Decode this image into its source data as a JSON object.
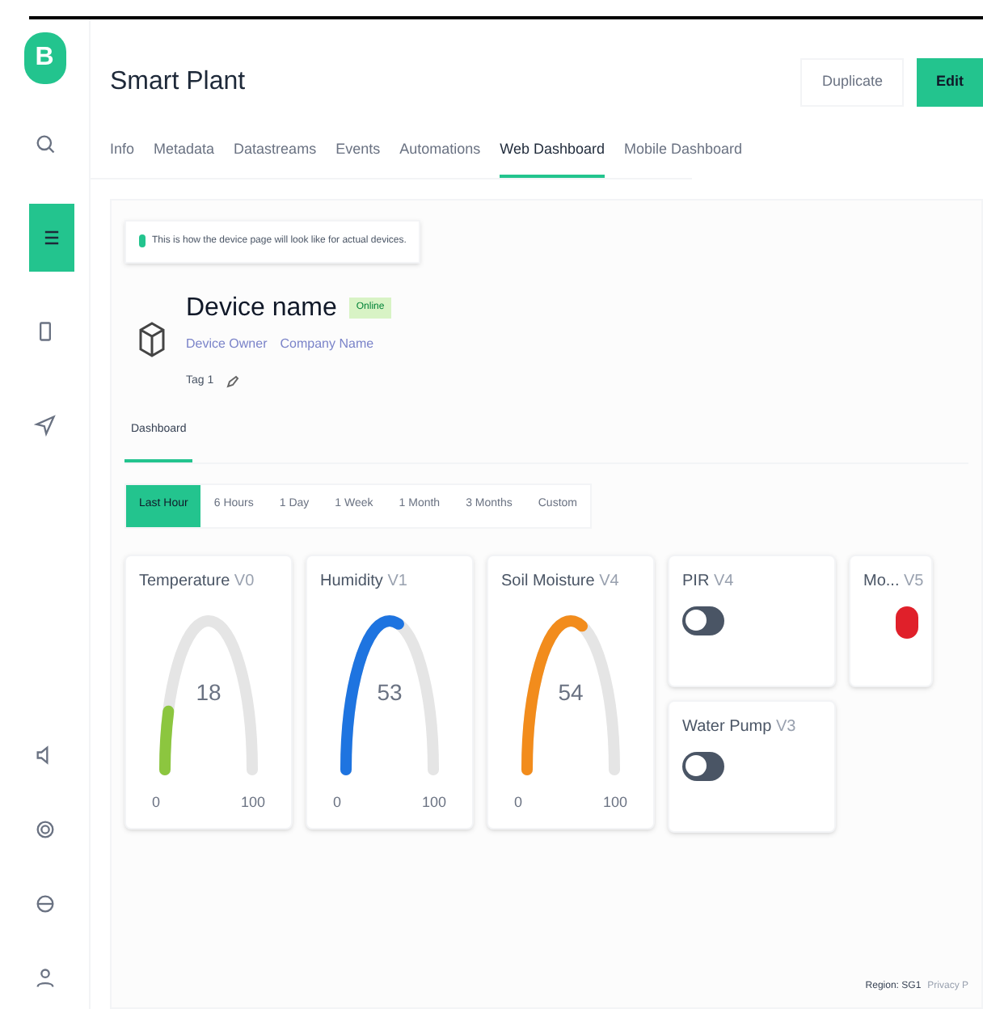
{
  "sidebar": {
    "logo": "B",
    "items": [
      {
        "selected": false
      },
      {
        "selected": true
      },
      {
        "selected": false
      },
      {
        "selected": false
      }
    ]
  },
  "header": {
    "title": "Smart Plant",
    "buttons": [
      {
        "label": "Duplicate",
        "kind": "secondary"
      },
      {
        "label": "Edit",
        "kind": "primary"
      }
    ]
  },
  "tabs": [
    {
      "label": "Info",
      "selected": false
    },
    {
      "label": "Metadata",
      "selected": false
    },
    {
      "label": "Datastreams",
      "selected": false
    },
    {
      "label": "Events",
      "selected": false
    },
    {
      "label": "Automations",
      "selected": false
    },
    {
      "label": "Web Dashboard",
      "selected": true
    },
    {
      "label": "Mobile Dashboard",
      "selected": false
    }
  ],
  "notice": "This is how the device page will look like for actual devices.",
  "device": {
    "name": "Device name",
    "status": "Online",
    "owner": "Device Owner",
    "company": "Company Name",
    "tag": "Tag 1"
  },
  "dashboard_tabs": [
    {
      "label": "Dashboard",
      "selected": true
    }
  ],
  "time_ranges": [
    {
      "label": "Last Hour",
      "selected": true
    },
    {
      "label": "6 Hours",
      "selected": false
    },
    {
      "label": "1 Day",
      "selected": false
    },
    {
      "label": "1 Week",
      "selected": false
    },
    {
      "label": "1 Month",
      "selected": false
    },
    {
      "label": "3 Months",
      "selected": false
    },
    {
      "label": "Custom",
      "selected": false
    }
  ],
  "widgets": [
    {
      "kind": "gauge",
      "title": "Temperature",
      "pin": "V0",
      "value": "18",
      "min": "0",
      "max": "100",
      "color": "#8cc63f"
    },
    {
      "kind": "gauge",
      "title": "Humidity",
      "pin": "V1",
      "value": "53",
      "min": "0",
      "max": "100",
      "color": "#1e74e0"
    },
    {
      "kind": "gauge",
      "title": "Soil Moisture",
      "pin": "V4",
      "value": "54",
      "min": "0",
      "max": "100",
      "color": "#f28c1c"
    },
    {
      "kind": "switch",
      "title": "PIR",
      "pin": "V4",
      "on": false
    },
    {
      "kind": "led",
      "title": "Mo...",
      "pin": "V5",
      "color": "#e0202a"
    },
    {
      "kind": "switch",
      "title": "Water Pump",
      "pin": "V3",
      "on": false
    }
  ],
  "footer": {
    "region": "Region: SG1",
    "link": "Privacy P"
  }
}
